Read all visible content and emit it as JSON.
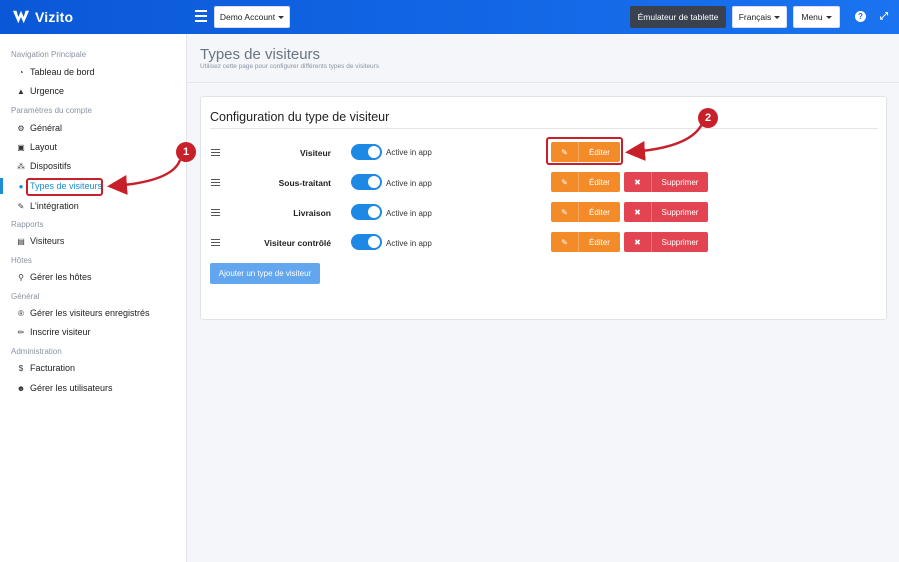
{
  "app": {
    "logo_text": "Vizito"
  },
  "topbar": {
    "account_label": "Demo Account",
    "tablet_emulator_label": "Émulateur de tablette",
    "language_label": "Français",
    "menu_label": "Menu",
    "help_icon": "question-circle-icon",
    "expand_icon": "expand-icon"
  },
  "sidebar": {
    "sections": [
      {
        "title": "Navigation Principale",
        "items": [
          {
            "label": "Tableau de bord",
            "icon": "dashboard-icon"
          },
          {
            "label": "Urgence",
            "icon": "warning-icon"
          }
        ]
      },
      {
        "title": "Paramètres du compte",
        "items": [
          {
            "label": "Général",
            "icon": "gear-icon"
          },
          {
            "label": "Layout",
            "icon": "image-icon"
          },
          {
            "label": "Dispositifs",
            "icon": "sitemap-icon"
          },
          {
            "label": "Types de visiteurs",
            "icon": "users-icon",
            "active": true
          },
          {
            "label": "L'intégration",
            "icon": "plug-icon"
          }
        ]
      },
      {
        "title": "Rapports",
        "items": [
          {
            "label": "Visiteurs",
            "icon": "book-icon"
          }
        ]
      },
      {
        "title": "Hôtes",
        "items": [
          {
            "label": "Gérer les hôtes",
            "icon": "user-tie-icon"
          }
        ]
      },
      {
        "title": "Général",
        "items": [
          {
            "label": "Gérer les visiteurs enregistrés",
            "icon": "registered-icon"
          },
          {
            "label": "Inscrire visiteur",
            "icon": "pencil-icon"
          }
        ]
      },
      {
        "title": "Administration",
        "items": [
          {
            "label": "Facturation",
            "icon": "dollar-icon"
          },
          {
            "label": "Gérer les utilisateurs",
            "icon": "user-cog-icon"
          }
        ]
      }
    ]
  },
  "page": {
    "title": "Types de visiteurs",
    "subtitle": "Utilisez cette page pour configurer différents types de visiteurs"
  },
  "card": {
    "title": "Configuration du type de visiteur",
    "rows": [
      {
        "name": "Visiteur",
        "toggle_label": "Active in app",
        "active": true,
        "edit_label": "Éditer",
        "delete_label": null
      },
      {
        "name": "Sous-traitant",
        "toggle_label": "Active in app",
        "active": true,
        "edit_label": "Éditer",
        "delete_label": "Supprimer"
      },
      {
        "name": "Livraison",
        "toggle_label": "Active in app",
        "active": true,
        "edit_label": "Éditer",
        "delete_label": "Supprimer"
      },
      {
        "name": "Visiteur contrôlé",
        "toggle_label": "Active in app",
        "active": true,
        "edit_label": "Éditer",
        "delete_label": "Supprimer"
      }
    ],
    "add_button_label": "Ajouter un type de visiteur"
  },
  "annotations": {
    "badge_1": "1",
    "badge_2": "2"
  },
  "colors": {
    "accent": "#1a73f0",
    "edit": "#f28b28",
    "delete": "#e34452",
    "highlight": "#c8202a"
  }
}
